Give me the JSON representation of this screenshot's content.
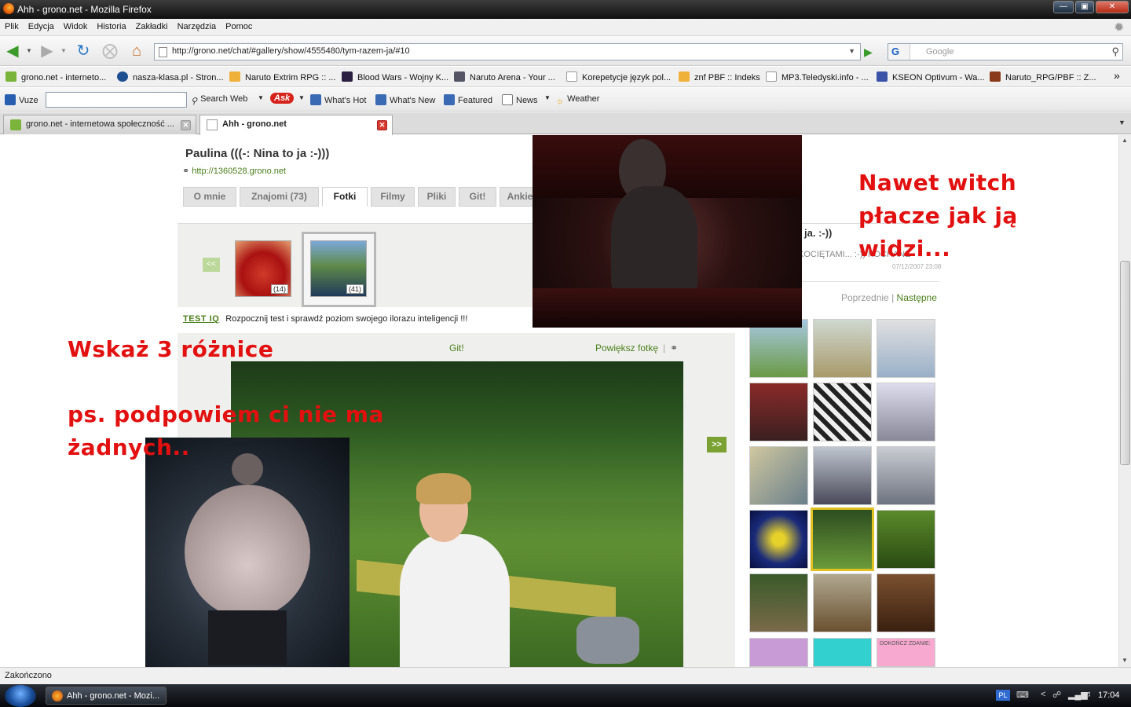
{
  "window": {
    "title": "Ahh - grono.net - Mozilla Firefox"
  },
  "menu": [
    "Plik",
    "Edycja",
    "Widok",
    "Historia",
    "Zakładki",
    "Narzędzia",
    "Pomoc"
  ],
  "nav": {
    "url": "http://grono.net/chat/#gallery/show/4555480/tym-razem-ja/#10",
    "search_placeholder": "Google",
    "search_engine": "G"
  },
  "bookmarks": [
    "grono.net - interneto...",
    "nasza-klasa.pl - Stron...",
    "Naruto Extrim RPG :: ...",
    "Blood Wars - Wojny K...",
    "Naruto Arena - Your ...",
    "Korepetycje język pol...",
    "znf PBF :: Indeks",
    "MP3.Teledyski.info - ...",
    "KSEON Optivum - Wa...",
    "Naruto_RPG/PBF :: Z..."
  ],
  "toolbar": {
    "label": "Vuze",
    "items": [
      "Search Web",
      "What's Hot",
      "What's New",
      "Featured",
      "News",
      "Weather"
    ]
  },
  "tabs": [
    {
      "label": "grono.net - internetowa społeczność ...",
      "active": false
    },
    {
      "label": "Ahh - grono.net",
      "active": true
    }
  ],
  "profile": {
    "name": "Paulina (((-: Nina to ja :-)))",
    "url": "http://1360528.grono.net",
    "tabs": [
      "O mnie",
      "Znajomi (73)",
      "Fotki",
      "Filmy",
      "Pliki",
      "Git!",
      "Ankie"
    ],
    "active_tab": "Fotki"
  },
  "gallery": {
    "prev": "<<",
    "next": ">>",
    "albums": [
      {
        "count": "(14)"
      },
      {
        "count": "(41)"
      }
    ],
    "test_label": "TEST IQ",
    "test_text": "Rozpocznij test i sprawdź poziom swojego ilorazu inteligencji !!!",
    "git": "Git!",
    "zoom": "Powiększ fotkę"
  },
  "sidebar": {
    "title": "ja. :-))",
    "description": "KOCIĘTAMI... :-)) KOCHANE",
    "date": "07/12/2007 23:08",
    "prev": "Poprzednie",
    "separator": "|",
    "next": "Następne",
    "thumbnail_tags": [
      "",
      "",
      "",
      "",
      "",
      "",
      "",
      "",
      "",
      "",
      "",
      "",
      "",
      "",
      "",
      "DOKOŃCZ ZDANIE:"
    ]
  },
  "overlay": {
    "witch_caption": [
      "Nawet witch",
      "płacze jak ją",
      "widzi..."
    ],
    "diff_caption": "Wskaż 3 różnice",
    "ps_caption": [
      "ps. podpowiem ci nie ma",
      "żadnych.."
    ]
  },
  "status": {
    "text": "Zakończono"
  },
  "taskbar": {
    "item": "Ahh - grono.net - Mozi...",
    "time": "17:04",
    "lang": "PL"
  },
  "colors": {
    "accent_green": "#4a7f1a",
    "overlay_red": "#e31010",
    "tab_close_red": "#d83b30"
  }
}
